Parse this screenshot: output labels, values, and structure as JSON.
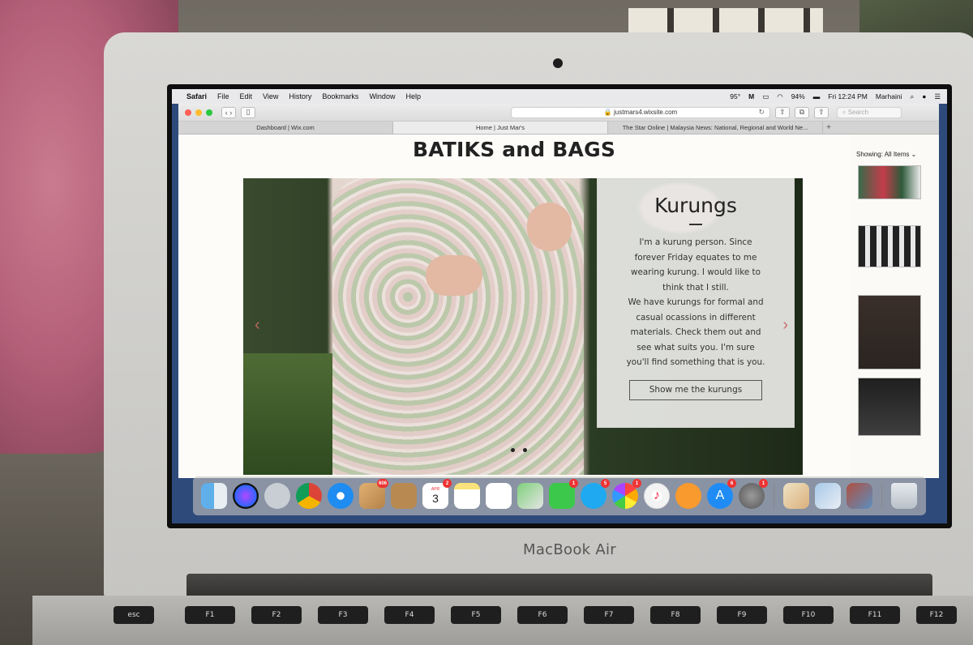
{
  "menubar": {
    "app_name": "Safari",
    "items": [
      "File",
      "Edit",
      "View",
      "History",
      "Bookmarks",
      "Window",
      "Help"
    ],
    "temperature": "95°",
    "battery": "94%",
    "clock": "Fri 12:24 PM",
    "user": "Marhaini"
  },
  "browser": {
    "url": "justmars4.wixsite.com",
    "search_placeholder": "Search",
    "tabs": [
      {
        "label": "Dashboard | Wix.com"
      },
      {
        "label": "Home | Just Mar's"
      },
      {
        "label": "The Star Online | Malaysia News: National, Regional and World Ne..."
      }
    ]
  },
  "site": {
    "title": "BATIKS and BAGS",
    "slide": {
      "heading": "Kurungs",
      "body_lines": [
        "I'm a kurung person. Since",
        "forever Friday equates  to me",
        "wearing kurung. I would like to",
        "think that I still.",
        "We have kurungs for formal and",
        "casual ocassions in different",
        "materials. Check them out and",
        "see what suits you. I'm sure",
        "you'll find something that is you."
      ],
      "button_label": "Show me the kurungs"
    },
    "sidebar": {
      "showing_label": "Showing:",
      "filter_value": "All Items"
    }
  },
  "dock": {
    "badges": {
      "photos_app": "606",
      "calendar": "2",
      "calendar_date": "3",
      "calendar_month": "APR",
      "facetime": "1",
      "messages": "5",
      "photos": "1",
      "app_store": "6",
      "system_prefs": "1"
    }
  },
  "hardware": {
    "brand": "MacBook Air",
    "keys": [
      "esc",
      "F1",
      "F2",
      "F3",
      "F4",
      "F5",
      "F6",
      "F7",
      "F8",
      "F9",
      "F10",
      "F11",
      "F12"
    ]
  }
}
